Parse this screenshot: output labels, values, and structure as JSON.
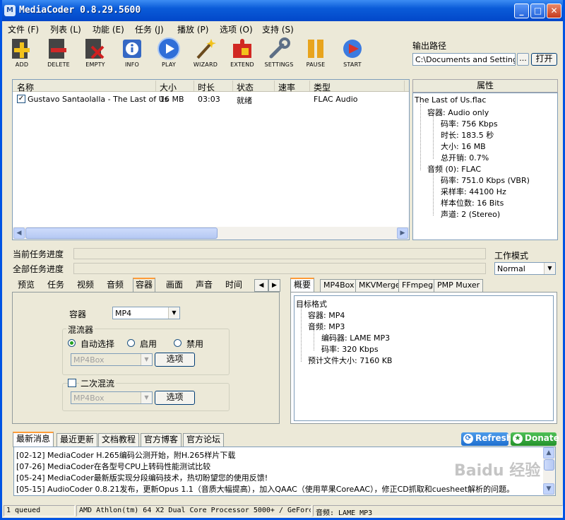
{
  "window": {
    "title": "MediaCoder 0.8.29.5600",
    "app_icon": "M",
    "minimize": "_",
    "maximize": "□",
    "close": "✕"
  },
  "menu": [
    "文件 (F)",
    "列表 (L)",
    "功能 (E)",
    "任务 (J)",
    "播放 (P)",
    "选项 (O)",
    "支持 (S)"
  ],
  "toolbar": [
    {
      "label": "ADD",
      "icon": "add-icon",
      "color": "#e9b01a"
    },
    {
      "label": "DELETE",
      "icon": "delete-icon",
      "color": "#c42020"
    },
    {
      "label": "EMPTY",
      "icon": "empty-icon",
      "color": "#b5191a"
    },
    {
      "label": "INFO",
      "icon": "info-icon",
      "color": "#2b5fb8"
    },
    {
      "label": "PLAY",
      "icon": "play-icon",
      "color": "#2f6ed8"
    },
    {
      "label": "WIZARD",
      "icon": "wizard-icon",
      "color": "#9d7a3c"
    },
    {
      "label": "EXTEND",
      "icon": "extend-icon",
      "color": "#d12822"
    },
    {
      "label": "SETTINGS",
      "icon": "settings-icon",
      "color": "#5d6f86"
    },
    {
      "label": "PAUSE",
      "icon": "pause-icon",
      "color": "#e8a41d"
    },
    {
      "label": "START",
      "icon": "start-icon",
      "color": "#d8342b"
    }
  ],
  "output": {
    "label": "输出路径",
    "path": "C:\\Documents and Settings\\A",
    "browse": "...",
    "open": "打开"
  },
  "file_list": {
    "headers": [
      "名称",
      "大小",
      "时长",
      "状态",
      "速率",
      "类型"
    ],
    "rows": [
      {
        "checked": "✓",
        "name": "Gustavo Santaolalla - The Last of Us",
        "size": "16 MB",
        "duration": "03:03",
        "status": "就绪",
        "rate": "",
        "type": "FLAC Audio"
      }
    ]
  },
  "properties": {
    "header": "属性",
    "lines": [
      "The Last of Us.flac",
      "容器: Audio only",
      "码率: 756 Kbps",
      "时长: 183.5 秒",
      "大小: 16 MB",
      "总开销: 0.7%",
      "音频 (0): FLAC",
      "码率: 751.0 Kbps (VBR)",
      "采样率: 44100 Hz",
      "样本位数: 16 Bits",
      "声道: 2 (Stereo)"
    ]
  },
  "progress": {
    "current_label": "当前任务进度",
    "total_label": "全部任务进度",
    "current": 0,
    "total": 0
  },
  "work_mode": {
    "label": "工作模式",
    "value": "Normal"
  },
  "left_tabs": [
    "预览",
    "任务",
    "视频",
    "音频",
    "容器",
    "画面",
    "声音",
    "时间"
  ],
  "left_tab_selected": "容器",
  "container": {
    "label": "容器",
    "value": "MP4",
    "muxer_group": "混流器",
    "radio_auto": "自动选择",
    "radio_enable": "启用",
    "radio_disable": "禁用",
    "muxer_value": "MP4Box",
    "options_btn": "选项",
    "second_mux": "二次混流",
    "second_value": "MP4Box",
    "second_btn": "选项"
  },
  "right_tabs": [
    "概要",
    "MP4Box",
    "MKVMerge",
    "FFmpeg",
    "PMP Muxer"
  ],
  "summary": [
    "目标格式",
    "容器: MP4",
    "音频: MP3",
    "编码器: LAME MP3",
    "码率: 320 Kbps",
    "预计文件大小: 7160 KB"
  ],
  "news_tabs": [
    "最新消息",
    "最近更新",
    "文档教程",
    "官方博客",
    "官方论坛"
  ],
  "buttons": {
    "refresh": "Refresh",
    "donate": "Donate"
  },
  "news": [
    "[02-12] MediaCoder H.265编码公测开始，附H.265样片下载",
    "[07-26] MediaCoder在各型号CPU上转码性能测试比较",
    "[05-24] MediaCoder最新版实现分段编码技术，热切盼望您的使用反馈!",
    "[05-15] AudioCoder 0.8.21发布，更新Opus 1.1（音质大幅提高），加入QAAC（使用苹果CoreAAC），修正CD抓取和cuesheet解析的问题。"
  ],
  "status": {
    "queue": "1 queued",
    "cpu": "AMD Athlon(tm) 64 X2 Dual Core Processor 5000+ / GeForc",
    "audio": "音频: LAME MP3"
  },
  "watermark": "Baidu 经验"
}
